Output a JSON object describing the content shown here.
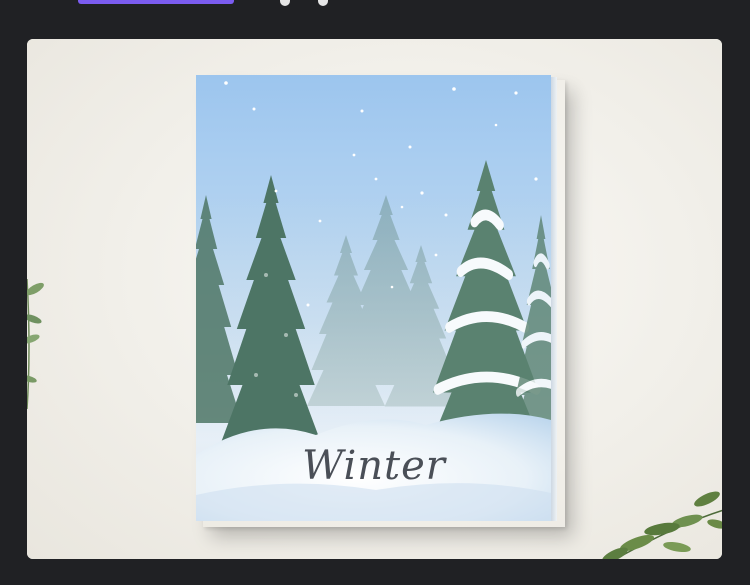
{
  "artwork": {
    "caption": "Winter",
    "colors": {
      "sky_top": "#9cc5ee",
      "sky_mid": "#b4d3ef",
      "snow": "#f4f8fc",
      "tree_dark": "#3f6b5a",
      "tree_mid": "#5c8a76",
      "text": "#4a4f57"
    }
  },
  "chrome": {
    "accent_color": "#7b5cf0",
    "background_color": "#202124",
    "card_color": "#f1efe9"
  }
}
